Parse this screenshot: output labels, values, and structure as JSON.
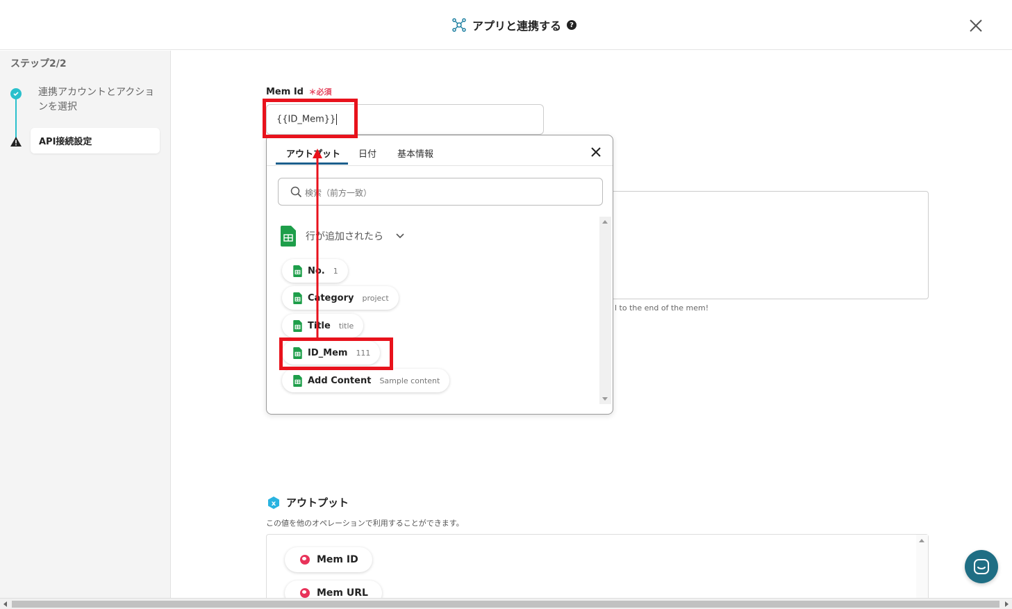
{
  "header": {
    "title": "アプリと連携する",
    "help_icon": "question-circle-icon"
  },
  "sidebar": {
    "step_count": "ステップ2/2",
    "steps": [
      {
        "label": "連携アカウントとアクションを選択",
        "status": "done"
      },
      {
        "label": "API接続設定",
        "status": "warning"
      }
    ]
  },
  "form": {
    "memid_label": "Mem Id",
    "required_label": "＊必須",
    "memid_value": "{{ID_Mem}}",
    "helper_text": "l to the end of the mem!"
  },
  "popup": {
    "tabs": [
      "アウトプット",
      "日付",
      "基本情報"
    ],
    "search_placeholder": "検索（前方一致）",
    "group_title": "行が追加されたら",
    "items": [
      {
        "name": "No.",
        "value": "1"
      },
      {
        "name": "Category",
        "value": "project"
      },
      {
        "name": "Title",
        "value": "title"
      },
      {
        "name": "ID_Mem",
        "value": "111"
      },
      {
        "name": "Add Content",
        "value": "Sample content"
      }
    ]
  },
  "output": {
    "title": "アウトプット",
    "description": "この値を他のオペレーションで利用することができます。",
    "items": [
      "Mem ID",
      "Mem URL"
    ]
  },
  "colors": {
    "accent": "#2ac0cc",
    "highlight": "#e8121c",
    "sheets_green": "#1e9e4a",
    "fab": "#1f6e84"
  }
}
